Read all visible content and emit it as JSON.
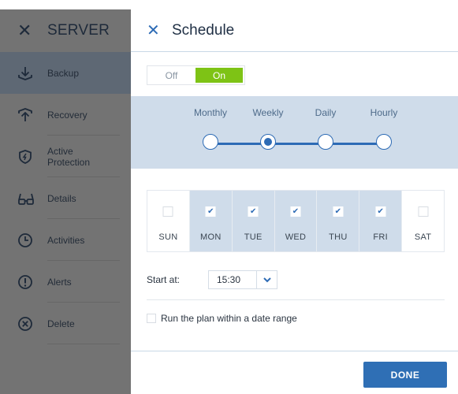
{
  "sidebar": {
    "title": "SERVER",
    "items": [
      {
        "label": "Backup",
        "icon": "backup-icon",
        "active": true
      },
      {
        "label": "Recovery",
        "icon": "recovery-icon"
      },
      {
        "label": "Active Protection",
        "icon": "shield-icon"
      },
      {
        "label": "Details",
        "icon": "glasses-icon"
      },
      {
        "label": "Activities",
        "icon": "clock-icon"
      },
      {
        "label": "Alerts",
        "icon": "alert-icon"
      },
      {
        "label": "Delete",
        "icon": "delete-icon"
      }
    ]
  },
  "panel": {
    "title": "Schedule",
    "toggle": {
      "off_label": "Off",
      "on_label": "On",
      "state": "On"
    },
    "frequency": {
      "options": [
        "Monthly",
        "Weekly",
        "Daily",
        "Hourly"
      ],
      "selected": "Weekly"
    },
    "days": [
      {
        "label": "SUN",
        "checked": false
      },
      {
        "label": "MON",
        "checked": true
      },
      {
        "label": "TUE",
        "checked": true
      },
      {
        "label": "WED",
        "checked": true
      },
      {
        "label": "THU",
        "checked": true
      },
      {
        "label": "FRI",
        "checked": true
      },
      {
        "label": "SAT",
        "checked": false
      }
    ],
    "start": {
      "label": "Start at:",
      "time": "15:30"
    },
    "date_range": {
      "label": "Run the plan within a date range",
      "checked": false
    },
    "done_label": "DONE"
  },
  "colors": {
    "accent": "#2d6bb5",
    "on_green": "#7ec315",
    "sidebar_bg": "#737373"
  }
}
